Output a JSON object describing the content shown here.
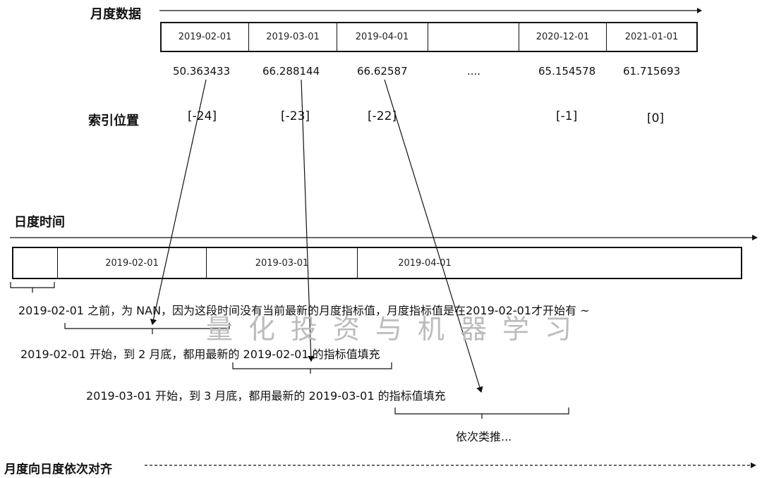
{
  "monthly": {
    "title": "月度数据",
    "dates": [
      "2019-02-01",
      "2019-03-01",
      "2019-04-01",
      "",
      "2020-12-01",
      "2021-01-01"
    ],
    "values": [
      "50.363433",
      "66.288144",
      "66.62587",
      "....",
      "65.154578",
      "61.715693"
    ]
  },
  "index": {
    "label": "索引位置",
    "positions": [
      "[-24]",
      "[-23]",
      "[-22]",
      "",
      "[-1]",
      "[0]"
    ]
  },
  "daily": {
    "title": "日度时间",
    "dates": [
      "2019-02-01",
      "2019-03-01",
      "2019-04-01"
    ]
  },
  "notes": {
    "line1": "2019-02-01 之前，为 NAN，因为这段时间没有当前最新的月度指标值，月度指标值是在2019-02-01才开始有 ~",
    "line2": "2019-02-01 开始，到 2 月底，都用最新的 2019-02-01 的指标值填充",
    "line3": "2019-03-01 开始，到 3 月底，都用最新的 2019-03-01 的指标值填充",
    "line4": "依次类推..."
  },
  "watermark": "量化投资与机器学习",
  "footer": "月度向日度依次对齐"
}
